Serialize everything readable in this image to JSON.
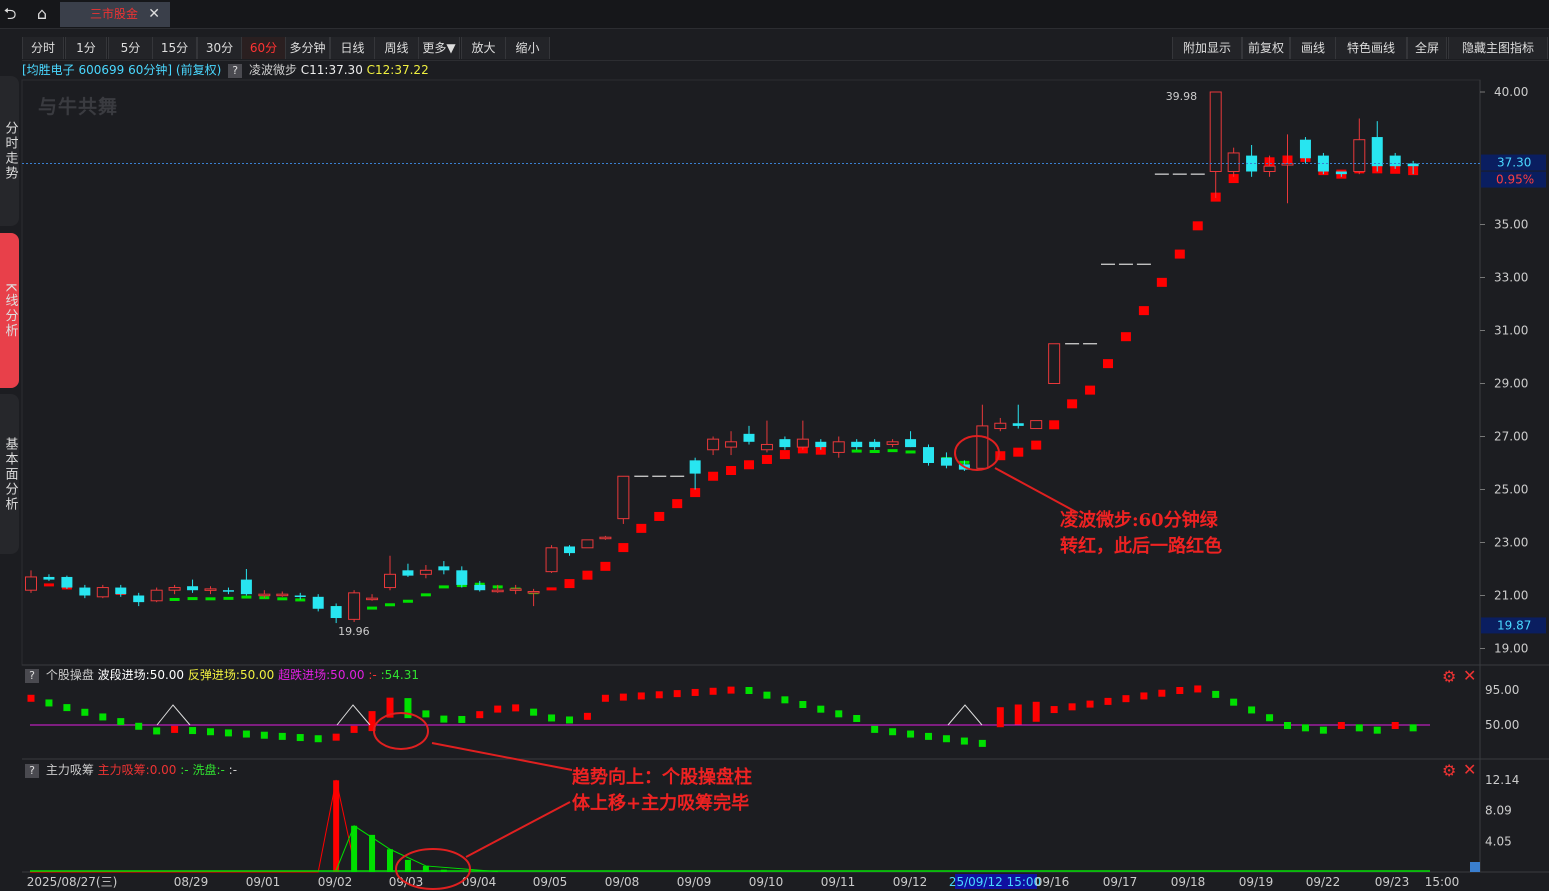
{
  "window": {
    "tab_title": "三市股金",
    "icons": [
      "back-icon",
      "home-icon",
      "close-icon"
    ]
  },
  "leftnav": [
    {
      "label": "分时走势"
    },
    {
      "label": "K线分析"
    },
    {
      "label": "基本面分析"
    }
  ],
  "toolbar_left": [
    "分时",
    "1分",
    "5分",
    "15分",
    "30分",
    "60分",
    "多分钟",
    "日线",
    "周线",
    "更多▼",
    "放大",
    "缩小"
  ],
  "toolbar_active": "60分",
  "toolbar_right": [
    "附加显示",
    "前复权",
    "画线",
    "特色画线",
    "全屏",
    "隐藏主图指标"
  ],
  "info": {
    "stock": "[均胜电子 600699 60分钟]",
    "adjust": "(前复权)",
    "indicator": "凌波微步",
    "c1": "C11:37.30",
    "c2": "C12:37.22"
  },
  "logo": "与牛共舞",
  "main_axis": {
    "ticks": [
      "40.00",
      "35.00",
      "33.00",
      "31.00",
      "29.00",
      "27.00",
      "25.00",
      "23.00",
      "21.00",
      "19.00"
    ],
    "current_price": "37.30",
    "change_pct": "0.95%",
    "low_label": "19.87",
    "high_mark": "39.98",
    "low_mark": "19.96"
  },
  "panel2": {
    "q": "?",
    "name": "个股操盘",
    "l1": "波段进场:50.00",
    "l2": "反弹进场:50.00",
    "l3": "超跌进场:50.00",
    "l4": ":-",
    "l5": ":54.31",
    "ticks": [
      "95.00",
      "50.00"
    ]
  },
  "panel3": {
    "q": "?",
    "name": "主力吸筹",
    "l1": "主力吸筹:0.00",
    "l2": ":-",
    "l3": "洗盘:-",
    "l4": ":-",
    "ticks": [
      "12.14",
      "8.09",
      "4.05"
    ]
  },
  "dates": [
    "2025/08/27(三)",
    "08/29",
    "09/01",
    "09/02",
    "09/03",
    "09/04",
    "09/05",
    "09/08",
    "09/09",
    "09/10",
    "09/11",
    "09/12",
    "25/09/12 15:00",
    "09/16",
    "09/17",
    "09/18",
    "09/19",
    "09/22",
    "09/23",
    "15:00"
  ],
  "annotations": {
    "a1_line1": "凌波微步:60分钟绿",
    "a1_line2": "转红，此后一路红色",
    "a2_line1": "趋势向上：个股操盘柱",
    "a2_line2": "体上移+主力吸筹完毕"
  },
  "colors": {
    "up": "#e8383a",
    "down": "#28e5f0",
    "red_step": "#ff0000",
    "green_step": "#00e000",
    "annot": "#e02020",
    "magenta": "#e020e0"
  },
  "chart_data": {
    "type": "candlestick",
    "ylim": [
      19.0,
      40.5
    ],
    "candles": [
      [
        21.2,
        21.7,
        21.1,
        21.95
      ],
      [
        21.7,
        21.6,
        21.55,
        21.8
      ],
      [
        21.7,
        21.3,
        21.25,
        21.75
      ],
      [
        21.3,
        21.0,
        20.9,
        21.4
      ],
      [
        20.95,
        21.3,
        20.9,
        21.4
      ],
      [
        21.3,
        21.05,
        20.95,
        21.4
      ],
      [
        21.0,
        20.75,
        20.6,
        21.1
      ],
      [
        20.8,
        21.2,
        20.75,
        21.3
      ],
      [
        21.2,
        21.3,
        21.05,
        21.4
      ],
      [
        21.35,
        21.2,
        21.1,
        21.6
      ],
      [
        21.2,
        21.25,
        21.05,
        21.35
      ],
      [
        21.2,
        21.15,
        21.05,
        21.3
      ],
      [
        21.6,
        21.05,
        21.0,
        22.0
      ],
      [
        21.0,
        21.05,
        20.9,
        21.2
      ],
      [
        21.0,
        21.05,
        20.95,
        21.15
      ],
      [
        21.0,
        20.95,
        20.85,
        21.1
      ],
      [
        20.95,
        20.5,
        20.4,
        21.05
      ],
      [
        20.6,
        20.15,
        19.96,
        20.7
      ],
      [
        20.1,
        21.1,
        20.0,
        21.2
      ],
      [
        20.85,
        20.9,
        20.8,
        21.05
      ],
      [
        21.3,
        21.8,
        21.2,
        22.5
      ],
      [
        21.95,
        21.75,
        21.7,
        22.2
      ],
      [
        21.8,
        21.95,
        21.65,
        22.15
      ],
      [
        22.1,
        21.95,
        21.8,
        22.3
      ],
      [
        21.95,
        21.4,
        21.3,
        22.1
      ],
      [
        21.4,
        21.2,
        21.15,
        21.55
      ],
      [
        21.2,
        21.2,
        21.1,
        21.4
      ],
      [
        21.2,
        21.25,
        21.05,
        21.4
      ],
      [
        21.15,
        21.15,
        20.6,
        21.25
      ],
      [
        21.9,
        22.8,
        21.85,
        22.9
      ],
      [
        22.85,
        22.6,
        22.5,
        22.9
      ],
      [
        22.8,
        23.1,
        22.8,
        23.1
      ],
      [
        23.2,
        23.2,
        23.1,
        23.25
      ],
      [
        23.9,
        25.5,
        23.7,
        25.5
      ],
      [
        25.5,
        25.5,
        25.5,
        25.5
      ],
      [
        25.5,
        25.5,
        25.5,
        25.5
      ],
      [
        25.5,
        25.5,
        25.5,
        25.5
      ],
      [
        26.1,
        25.6,
        25.0,
        26.2
      ],
      [
        26.5,
        26.9,
        26.3,
        27.0
      ],
      [
        26.6,
        26.8,
        26.3,
        27.2
      ],
      [
        27.1,
        26.8,
        26.7,
        27.4
      ],
      [
        26.5,
        26.7,
        26.4,
        27.6
      ],
      [
        26.9,
        26.6,
        26.5,
        27.0
      ],
      [
        26.6,
        26.9,
        26.5,
        27.6
      ],
      [
        26.8,
        26.6,
        26.5,
        26.9
      ],
      [
        26.4,
        26.8,
        26.2,
        27.0
      ],
      [
        26.8,
        26.6,
        26.5,
        26.9
      ],
      [
        26.8,
        26.6,
        26.5,
        26.9
      ],
      [
        26.7,
        26.8,
        26.6,
        26.9
      ],
      [
        26.9,
        26.6,
        26.6,
        27.2
      ],
      [
        26.6,
        26.0,
        25.9,
        26.7
      ],
      [
        26.2,
        25.9,
        25.8,
        26.4
      ],
      [
        25.95,
        25.75,
        25.7,
        26.1
      ],
      [
        25.8,
        27.4,
        25.8,
        28.2
      ],
      [
        27.3,
        27.5,
        27.2,
        27.7
      ],
      [
        27.5,
        27.4,
        27.3,
        28.2
      ],
      [
        27.3,
        27.6,
        27.3,
        27.6
      ],
      [
        29.0,
        30.5,
        29.0,
        30.5
      ],
      [
        30.5,
        30.5,
        30.5,
        30.5
      ],
      [
        30.5,
        30.5,
        30.5,
        30.5
      ],
      [
        33.5,
        33.5,
        33.5,
        33.5
      ],
      [
        33.5,
        33.5,
        33.5,
        33.5
      ],
      [
        33.5,
        33.5,
        33.5,
        33.5
      ],
      [
        36.9,
        36.9,
        36.9,
        36.9
      ],
      [
        36.9,
        36.9,
        36.9,
        36.9
      ],
      [
        36.9,
        36.9,
        36.9,
        36.9
      ],
      [
        37.0,
        40.0,
        36.0,
        40.0
      ],
      [
        37.0,
        37.7,
        36.8,
        37.9
      ],
      [
        37.6,
        37.0,
        36.8,
        38.0
      ],
      [
        37.0,
        37.2,
        36.8,
        37.6
      ],
      [
        37.3,
        37.3,
        35.8,
        38.4
      ],
      [
        38.2,
        37.5,
        37.3,
        38.3
      ],
      [
        37.6,
        37.0,
        36.9,
        37.7
      ],
      [
        37.0,
        36.9,
        36.8,
        37.0
      ],
      [
        37.0,
        38.2,
        36.9,
        39.0
      ],
      [
        38.3,
        37.2,
        37.0,
        38.9
      ],
      [
        37.6,
        37.2,
        37.1,
        37.7
      ],
      [
        37.3,
        37.2,
        36.9,
        37.4
      ]
    ],
    "osc_ticks": [
      95.0,
      50.0
    ],
    "accum_ticks": [
      12.14,
      8.09,
      4.05
    ]
  }
}
